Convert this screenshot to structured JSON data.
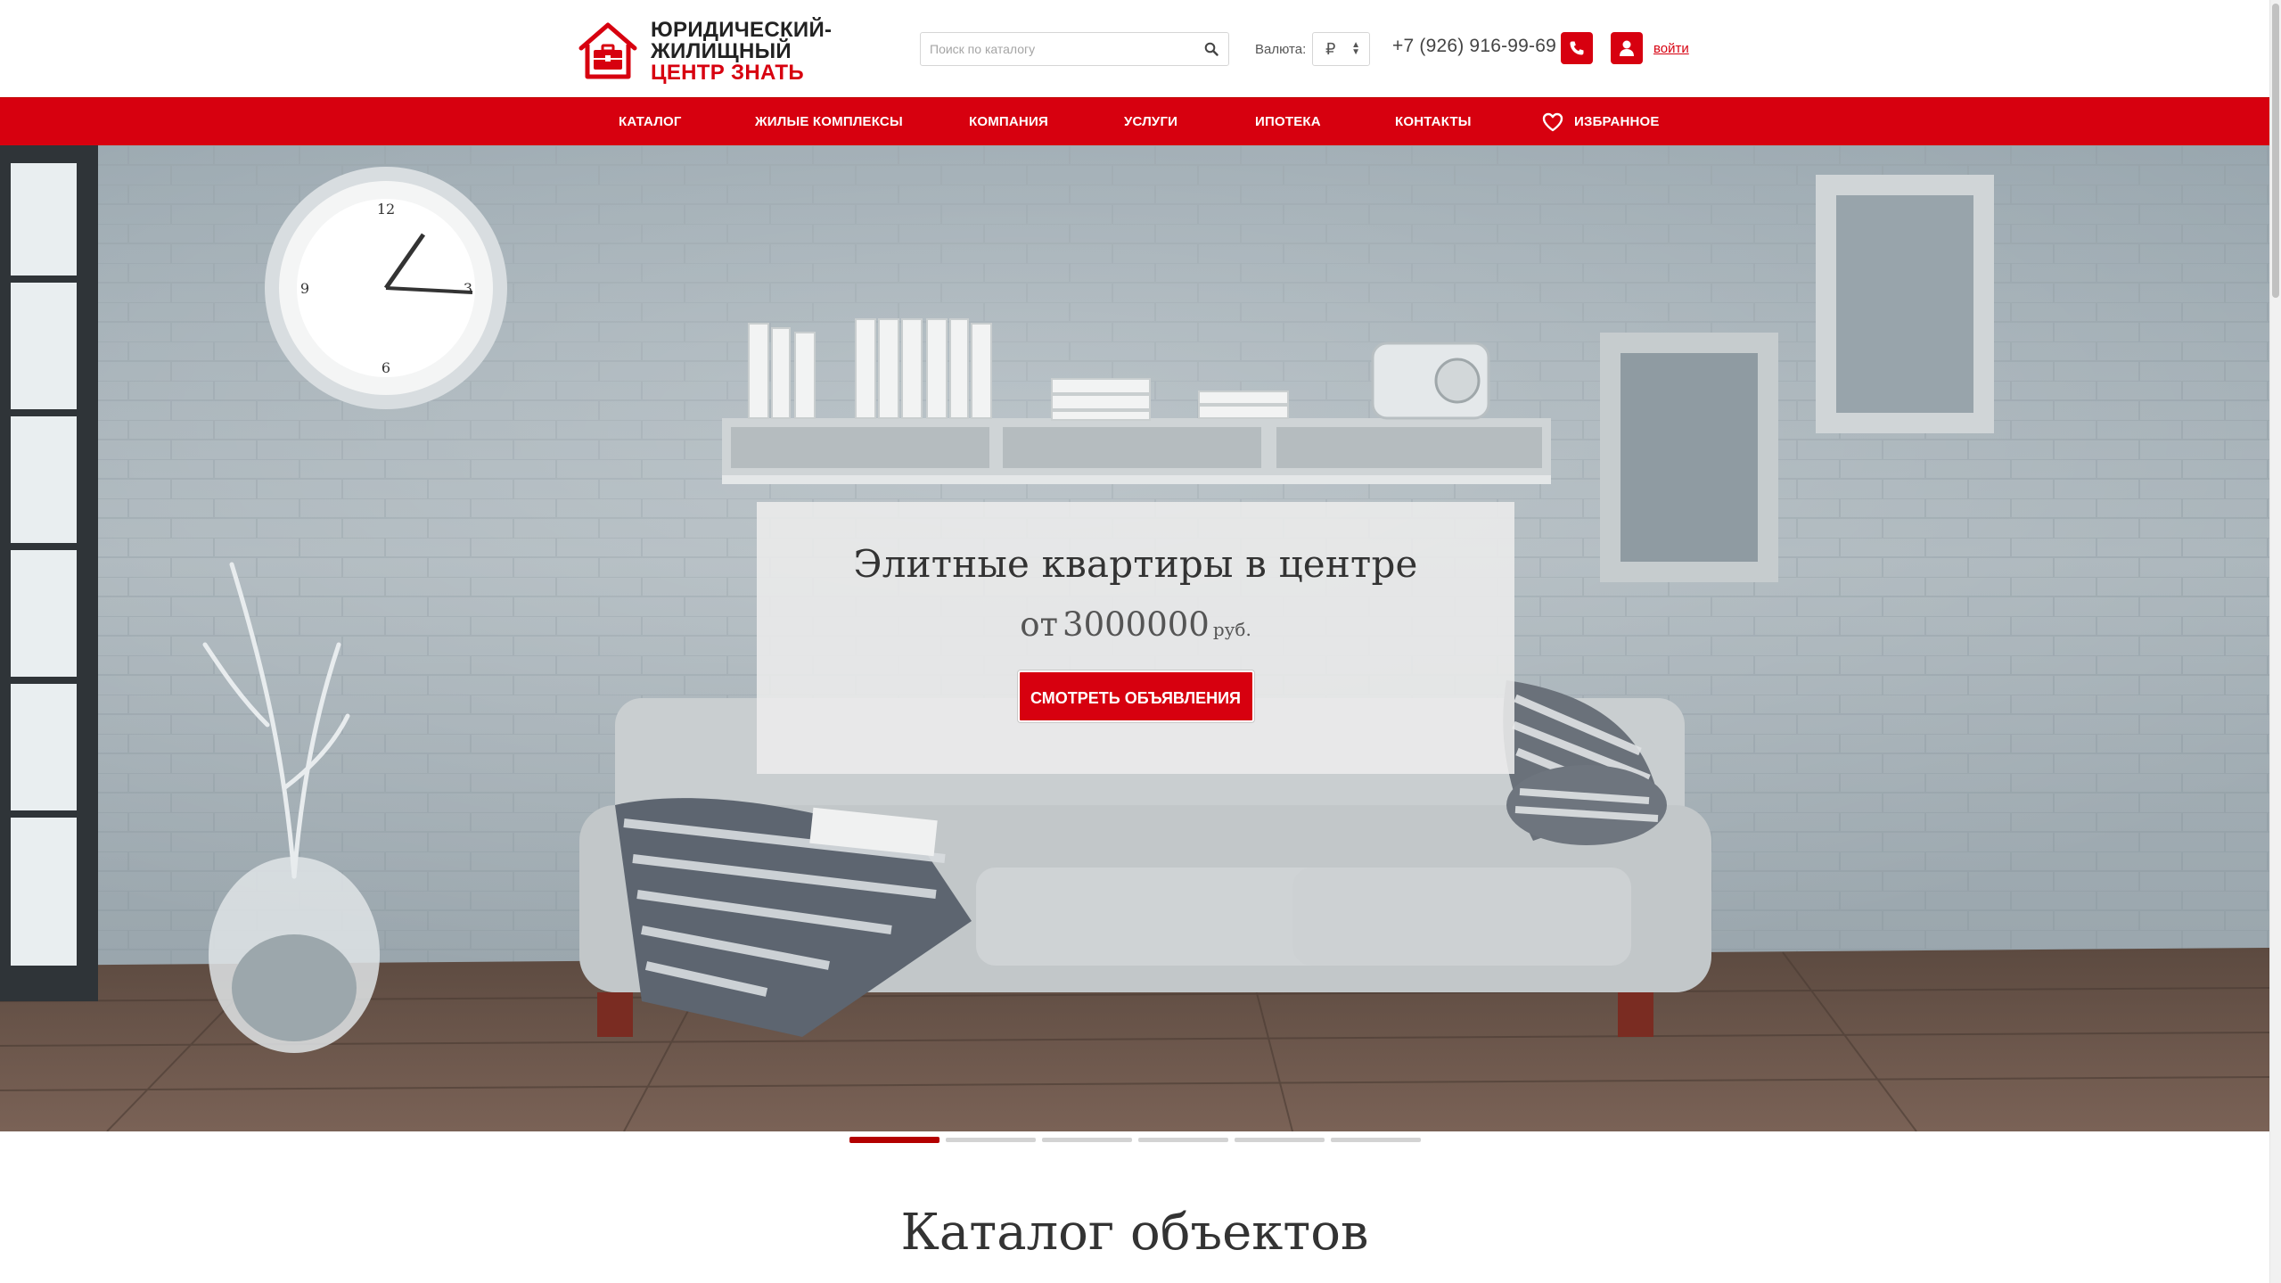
{
  "brand": {
    "line1": "ЮРИДИЧЕСКИЙ-",
    "line2": "ЖИЛИЩНЫЙ",
    "line3": "ЦЕНТР ЗНАТЬ",
    "accent_color": "#d7000f"
  },
  "header": {
    "search_placeholder": "Поиск по каталогу",
    "search_icon": "search-icon",
    "currency_label": "Валюта:",
    "currency_value": "₽",
    "phone": "+7 (926) 916-99-69",
    "phone_icon": "phone-icon",
    "user_icon": "user-icon",
    "login_label": "войти"
  },
  "nav": {
    "items": [
      {
        "label": "Каталог"
      },
      {
        "label": "Жилые комплексы"
      },
      {
        "label": "Компания"
      },
      {
        "label": "Услуги"
      },
      {
        "label": "Ипотека"
      },
      {
        "label": "Контакты"
      },
      {
        "label": "Избранное",
        "icon": "heart-icon"
      }
    ]
  },
  "hero": {
    "title": "Элитные квартиры в центре",
    "price_prefix": "от",
    "price_amount": "3000000",
    "price_currency": "руб.",
    "button_label": "Смотреть объявления",
    "slides_total": 6,
    "active_slide": 1
  },
  "catalog": {
    "title": "Каталог объектов"
  }
}
